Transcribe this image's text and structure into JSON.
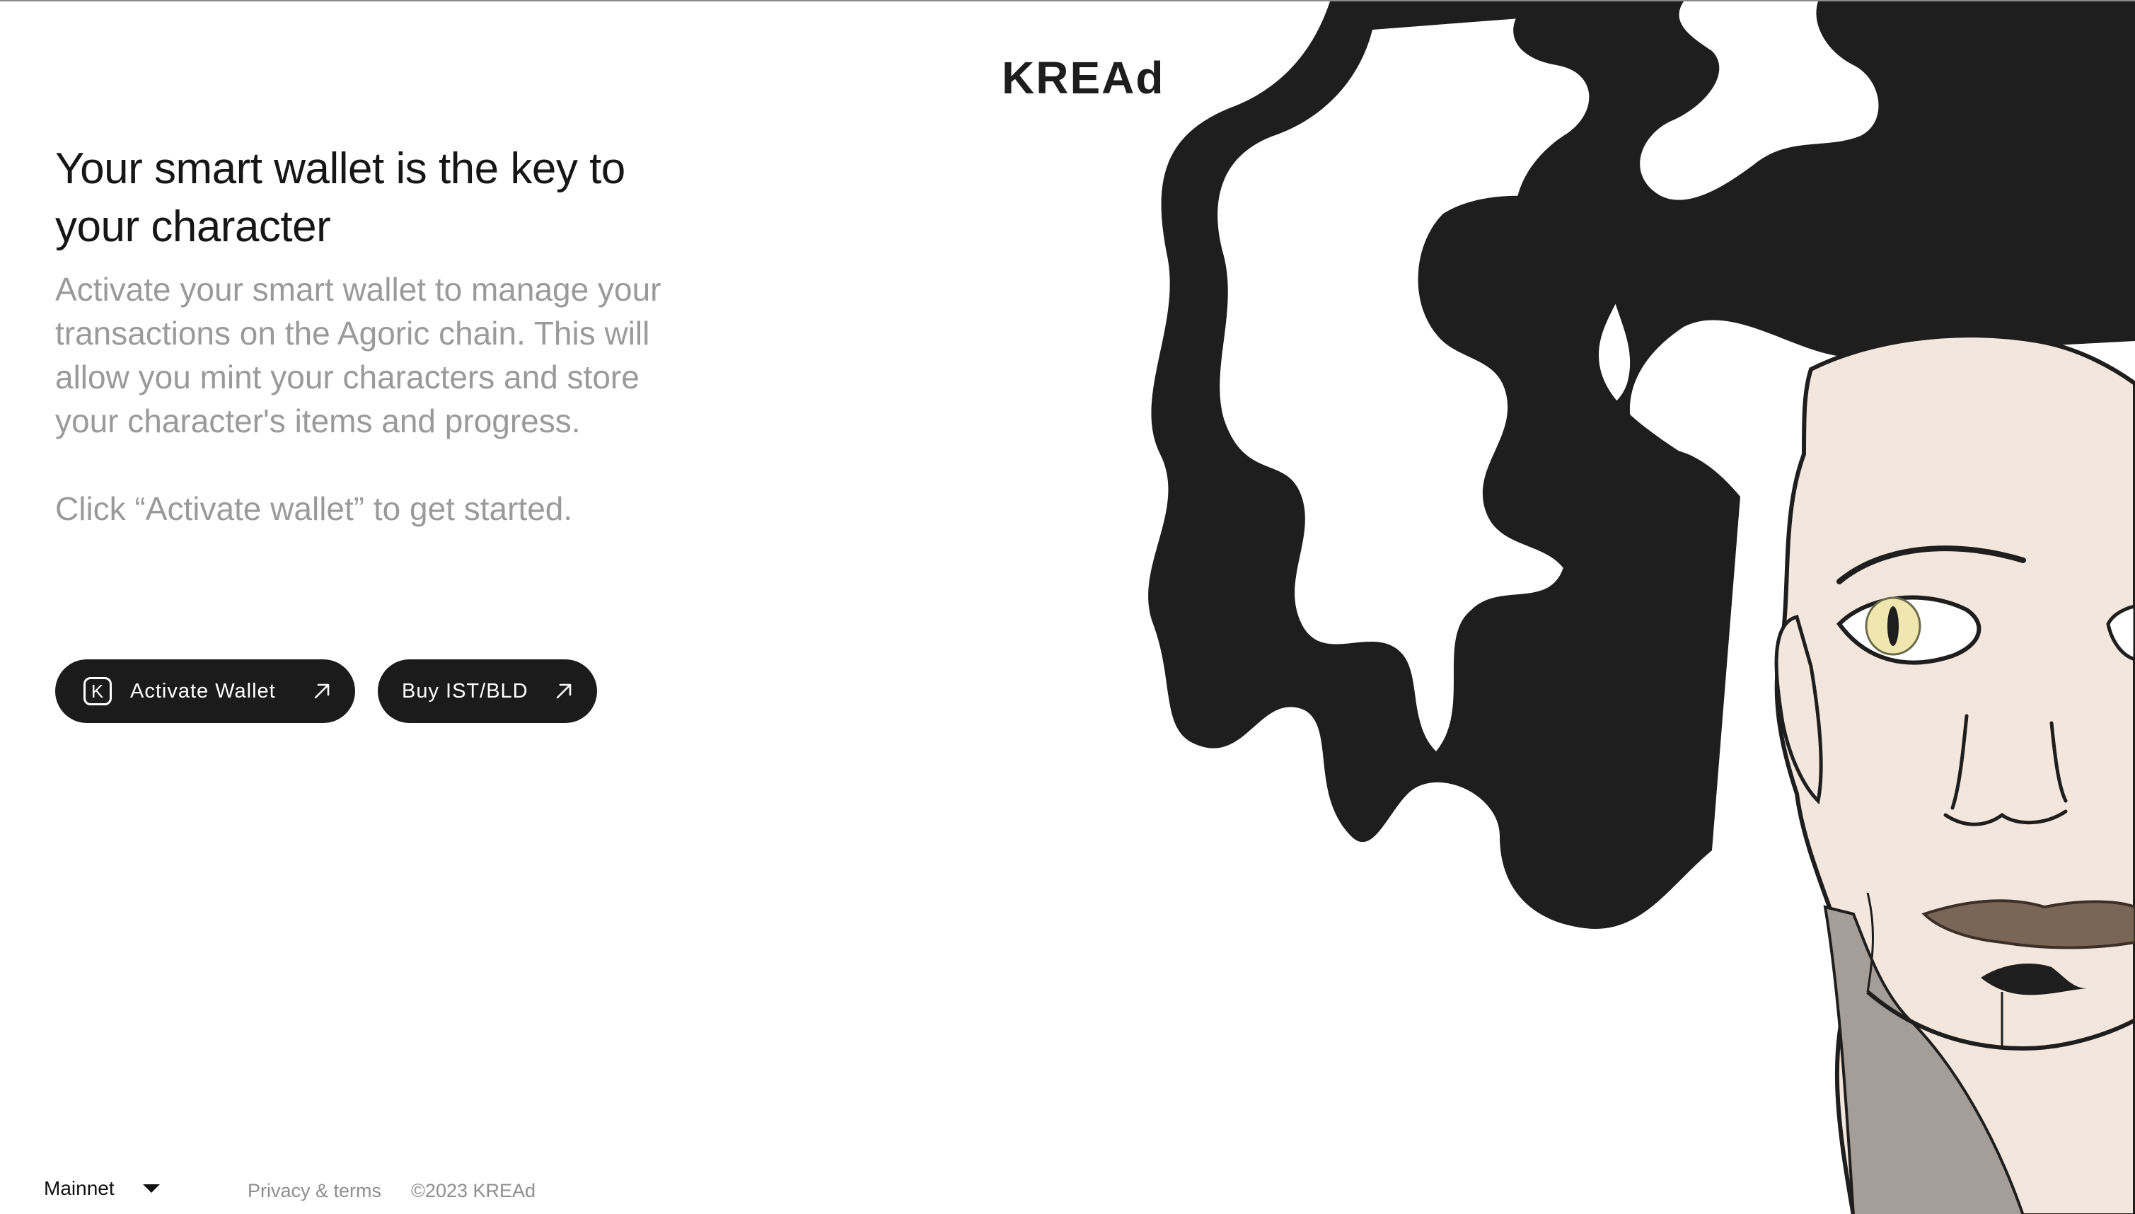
{
  "brand": {
    "logo_text": "KREAd"
  },
  "intro": {
    "headline": "Your smart wallet is the key to your character",
    "description": "Activate your smart wallet to manage your transactions on the Agoric chain. This will allow you mint your characters and store your character's items and progress.",
    "instruction": "Click “Activate wallet” to get started."
  },
  "actions": {
    "activate_wallet": {
      "badge": "K",
      "label": "Activate Wallet",
      "icon": "arrow-up-right-icon"
    },
    "buy": {
      "label": "Buy IST/BLD",
      "icon": "arrow-up-right-icon"
    }
  },
  "footer": {
    "network": "Mainnet",
    "network_icon": "caret-down-icon",
    "privacy_link": "Privacy & terms",
    "copyright": "©2023 KREAd"
  },
  "colors": {
    "background": "#ffffff",
    "button_bg": "#1b1b1b",
    "button_text": "#ffffff",
    "headline": "#161616",
    "muted_text": "#9a9a9a",
    "skin": "#f3e6dc",
    "hair": "#1e1e1e",
    "eye": "#f0e6b0",
    "lips": "#7a6656"
  }
}
